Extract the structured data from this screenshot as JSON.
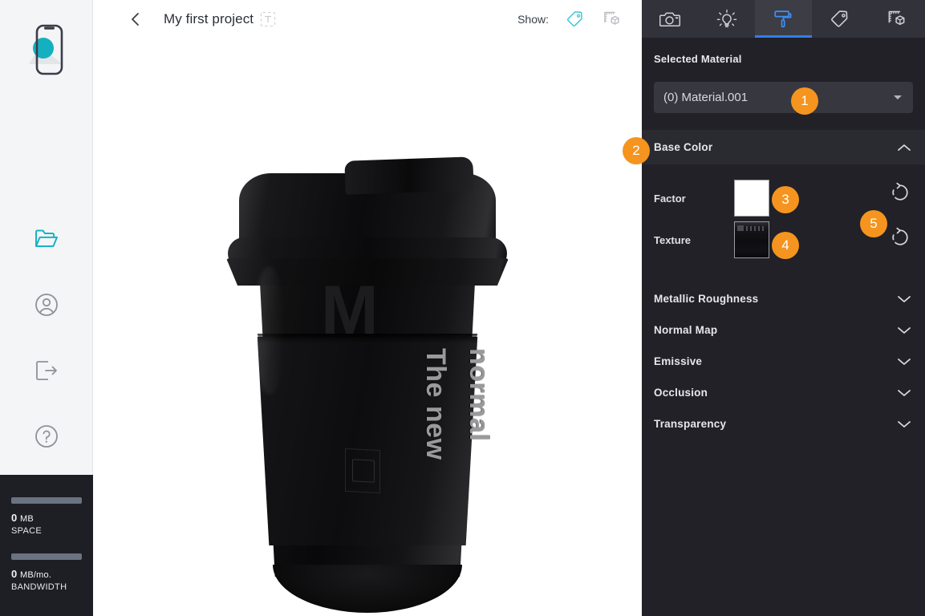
{
  "sidebar": {
    "logo_name": "phone-app-logo",
    "items": [
      {
        "name": "projects",
        "icon": "folder-open-icon",
        "active": true
      },
      {
        "name": "account",
        "icon": "user-circle-icon",
        "active": false
      },
      {
        "name": "logout",
        "icon": "logout-icon",
        "active": false
      },
      {
        "name": "help",
        "icon": "help-circle-icon",
        "active": false
      }
    ],
    "usage": [
      {
        "value": "0",
        "unit": "MB",
        "label": "SPACE",
        "fill_pct": 100,
        "bar_color": "#6b7280"
      },
      {
        "value": "0",
        "unit": "MB/mo.",
        "label": "BANDWIDTH",
        "fill_pct": 100,
        "bar_color": "#6b7280"
      }
    ]
  },
  "topbar": {
    "back_icon": "chevron-left-icon",
    "project_title": "My first project",
    "edit_title_icon": "text-edit-icon",
    "show_label": "Show:",
    "show_toggles": [
      {
        "name": "annotations",
        "icon": "tag-icon",
        "active": true,
        "color": "#3fc8d6"
      },
      {
        "name": "dimensions",
        "icon": "measure-cube-icon",
        "active": false,
        "color": "#b9bdc4"
      }
    ]
  },
  "viewport": {
    "model_name": "black-coffee-cup",
    "sleeve_text_line1": "The new",
    "sleeve_text_line2": "normal",
    "background": "#ffffff"
  },
  "panel": {
    "accent_color": "#2f7ff0",
    "background": "#212127",
    "tabs": [
      {
        "name": "camera",
        "icon": "camera-icon",
        "active": false
      },
      {
        "name": "lighting",
        "icon": "lightbulb-icon",
        "active": false
      },
      {
        "name": "materials",
        "icon": "paint-roller-icon",
        "active": true
      },
      {
        "name": "annotations",
        "icon": "tag-icon",
        "active": false
      },
      {
        "name": "dimensions",
        "icon": "measure-cube-icon",
        "active": false
      }
    ],
    "selected_material": {
      "title": "Selected Material",
      "value": "(0) Material.001",
      "dropdown_icon": "caret-down-icon"
    },
    "base_color": {
      "label": "Base Color",
      "expanded": true,
      "chevron_icon": "chevron-up-icon",
      "factor": {
        "label": "Factor",
        "color": "#ffffff",
        "reset_icon": "reset-icon"
      },
      "texture": {
        "label": "Texture",
        "reset_icon": "reset-icon"
      }
    },
    "sections": [
      {
        "label": "Metallic Roughness",
        "expanded": false,
        "chevron_icon": "chevron-down-icon"
      },
      {
        "label": "Normal Map",
        "expanded": false,
        "chevron_icon": "chevron-down-icon"
      },
      {
        "label": "Emissive",
        "expanded": false,
        "chevron_icon": "chevron-down-icon"
      },
      {
        "label": "Occlusion",
        "expanded": false,
        "chevron_icon": "chevron-down-icon"
      },
      {
        "label": "Transparency",
        "expanded": false,
        "chevron_icon": "chevron-down-icon"
      }
    ]
  },
  "annotations": {
    "badge_color": "#f5941f",
    "badges": [
      {
        "num": "1",
        "target": "material-dropdown"
      },
      {
        "num": "2",
        "target": "base-color-header"
      },
      {
        "num": "3",
        "target": "factor-swatch"
      },
      {
        "num": "4",
        "target": "texture-swatch"
      },
      {
        "num": "5",
        "target": "reset-buttons"
      }
    ]
  }
}
